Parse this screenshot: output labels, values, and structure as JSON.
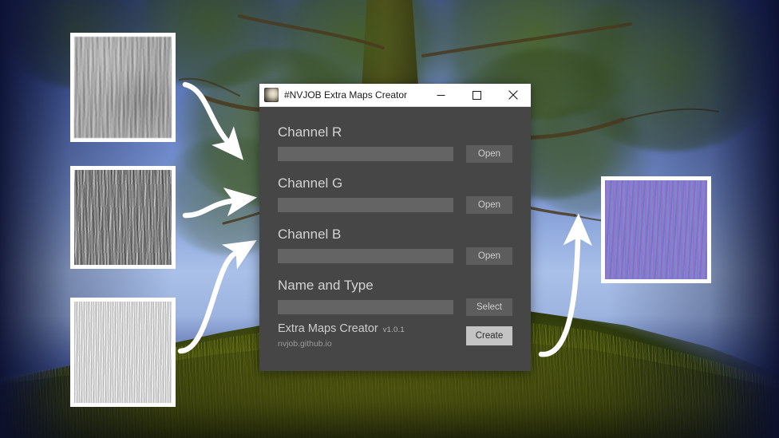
{
  "window": {
    "title": "#NVJOB Extra Maps Creator",
    "icon": "app-logo-icon",
    "minimize_label": "─",
    "maximize_label": "☐",
    "close_label": "✕"
  },
  "fields": [
    {
      "label": "Channel R",
      "value": "",
      "placeholder": "",
      "button": "Open",
      "key": "channel-r"
    },
    {
      "label": "Channel G",
      "value": "",
      "placeholder": "",
      "button": "Open",
      "key": "channel-g"
    },
    {
      "label": "Channel B",
      "value": "",
      "placeholder": "",
      "button": "Open",
      "key": "channel-b"
    },
    {
      "label": "Name and Type",
      "value": "",
      "placeholder": "",
      "button": "Select",
      "key": "name-and-type"
    }
  ],
  "footer": {
    "app_name": "Extra Maps Creator",
    "version": "v1.0.1",
    "url": "nvjob.github.io",
    "create_label": "Create"
  },
  "thumbnails": [
    {
      "name": "source-texture-normal",
      "alt": "gray bumpy normal map texture"
    },
    {
      "name": "source-texture-roughness",
      "alt": "gray high-contrast bark roughness texture"
    },
    {
      "name": "source-texture-occlusion",
      "alt": "light white noisy occlusion texture"
    },
    {
      "name": "output-texture-packed",
      "alt": "purple blue channel-packed output texture"
    }
  ],
  "colors": {
    "dialog_bg": "#464646",
    "titlebar_bg": "#ffffff",
    "input_bg": "#646464",
    "button_bg": "#5d5d5d",
    "create_button_bg": "#c4c4c4",
    "label_text": "#d3d3d3",
    "arrow": "#ffffff"
  },
  "scene": {
    "description": "3D tree on grass hill against blue sky"
  }
}
